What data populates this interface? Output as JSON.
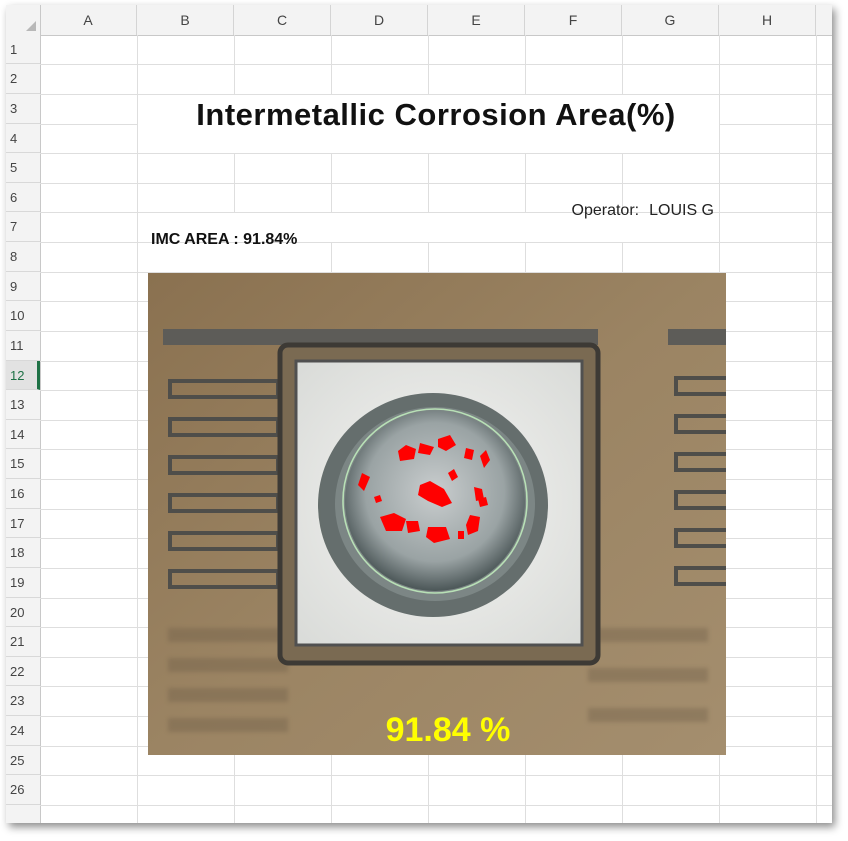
{
  "sheet": {
    "columns": [
      "A",
      "B",
      "C",
      "D",
      "E",
      "F",
      "G",
      "H"
    ],
    "rows": [
      "1",
      "2",
      "3",
      "4",
      "5",
      "6",
      "7",
      "8",
      "9",
      "10",
      "11",
      "12",
      "13",
      "14",
      "15",
      "16",
      "17",
      "18",
      "19",
      "20",
      "21",
      "22",
      "23",
      "24",
      "25",
      "26"
    ],
    "active_row": "12"
  },
  "report": {
    "title": "Intermetallic Corrosion Area(%)",
    "operator_label": "Operator:",
    "operator_name": "LOUIS G",
    "imc_area_text": "IMC AREA : 91.84%"
  },
  "micrograph": {
    "overlay_value": "91.84 %",
    "overlay_color": "#ffff00",
    "highlight_color": "#ff0000"
  }
}
